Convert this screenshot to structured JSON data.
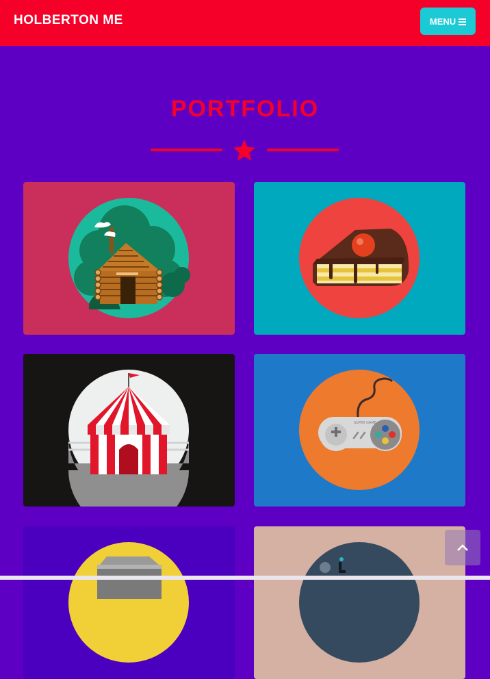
{
  "navbar": {
    "brand": "HOLBERTON ME",
    "menu_label": "MENU"
  },
  "portfolio": {
    "title": "PORTFOLIO",
    "items": [
      {
        "name": "cabin",
        "bg": "#c92f5a"
      },
      {
        "name": "cake",
        "bg": "#00a9bd"
      },
      {
        "name": "circus",
        "bg": "#171414"
      },
      {
        "name": "game-controller",
        "bg": "#1e79c9"
      },
      {
        "name": "safe",
        "bg": "#4b00c0"
      },
      {
        "name": "submarine",
        "bg": "#d4b1a3"
      }
    ],
    "controller_text": "SUPER GAME"
  },
  "colors": {
    "navbar": "#f50029",
    "page": "#5e00c4",
    "accent": "#f50029",
    "menu_button": "#1ccad5"
  },
  "icons": {
    "menu": "bars-icon",
    "divider": "star-icon",
    "scroll_top": "chevron-up-icon"
  }
}
